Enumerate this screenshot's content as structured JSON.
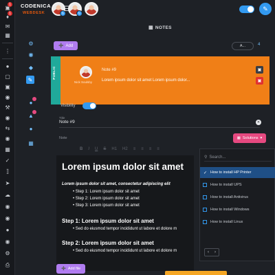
{
  "app": {
    "brand_name": "CODENICA",
    "brand_sub": "WEBDESK"
  },
  "rail": {
    "badges": [
      "1",
      "1"
    ],
    "icons": [
      "bag-icon",
      "bell-icon",
      "mail-icon",
      "calendar-icon",
      "more-icon",
      "user-icon",
      "folder-icon",
      "cart-icon",
      "target-icon",
      "tools-icon",
      "swap-icon",
      "globe-icon",
      "chart-icon",
      "check-icon",
      "rocket-icon",
      "cloud-icon",
      "card-icon",
      "chat-icon",
      "chat-icon",
      "chat-icon",
      "user-icon",
      "globe-icon",
      "settings-icon",
      "printer-icon"
    ]
  },
  "page": {
    "title": "NOTES",
    "add_label": "Add",
    "sort_label": "A...",
    "count_label": "4"
  },
  "note_card": {
    "side_label": "PUBLIC",
    "author": "Nick Soulsby",
    "title": "Note #9",
    "text": "Lorem ipsum dolor sit amet Lorem ipsum dolor..."
  },
  "form": {
    "visibility_label": "Visibility",
    "title_label": "Title",
    "title_value": "Note #9",
    "note_label": "Note",
    "solutions_label": "Solutions",
    "add_file_label": "Add file"
  },
  "toolbar": [
    "B",
    "I",
    "U",
    "S",
    "H1",
    "H2",
    "≡",
    "≡",
    "≡",
    "≡"
  ],
  "editor": {
    "heading": "Lorem ipsum dolor sit amet",
    "intro": "Lorem ipsum dolor sit amet, consectetur adipiscing elit",
    "steps": [
      "Step 1: Lorem ipsum dolor sit amet",
      "Step 2: Lorem ipsum dolor sit amet",
      "Step 3: Lorem ipsum dolor sit amet"
    ],
    "section1_title": "Step 1: Lorem ipsum dolor sit amet",
    "section1_line": "Sed do eiusmod tempor incididunt ut labore et dolore m",
    "section2_title": "Step 2: Lorem ipsum dolor sit amet",
    "section2_line": "Sed do eiusmod tempor incididunt ut labore et dolore m"
  },
  "dropdown": {
    "search_placeholder": "Search...",
    "items": [
      "How to install HP Printer",
      "How to install UPS",
      "How to install Antivirus",
      "How to install Windows",
      "How to install Linux"
    ],
    "selected_index": 0
  },
  "colors": {
    "accent": "#339af0",
    "card_bg": "#f07f17",
    "card_strip": "#20a99a",
    "add_button": "#b07cf0",
    "solutions_button": "#e64980"
  }
}
